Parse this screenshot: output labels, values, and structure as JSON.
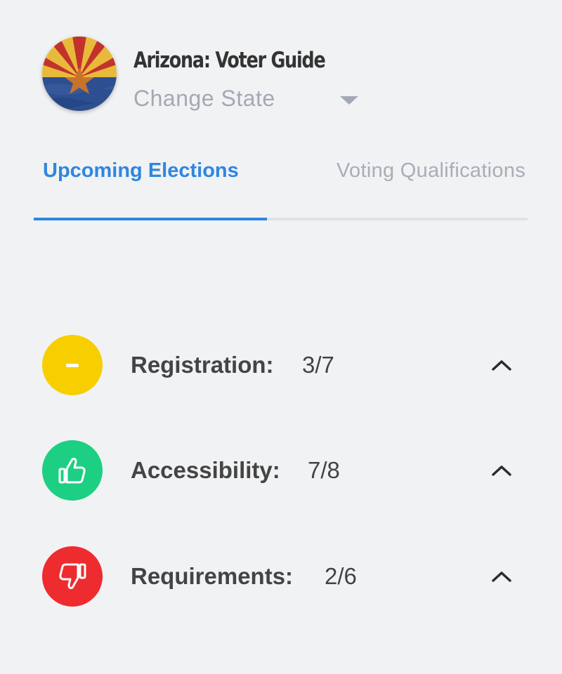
{
  "header": {
    "title": "Arizona: Voter Guide",
    "change_state_label": "Change State",
    "flag_icon": "arizona-flag-icon",
    "dropdown_icon": "caret-down-icon"
  },
  "tabs": [
    {
      "label": "Upcoming Elections",
      "active": true
    },
    {
      "label": "Voting Qualifications",
      "active": false
    }
  ],
  "colors": {
    "accent": "#2f86e0",
    "neutral": "#f7cf00",
    "positive": "#1ccf83",
    "negative": "#ee2b2f"
  },
  "categories": [
    {
      "label": "Registration:",
      "score": "3/7",
      "status": "neutral",
      "icon": "minus-icon"
    },
    {
      "label": "Accessibility:",
      "score": "7/8",
      "status": "positive",
      "icon": "thumbs-up-icon"
    },
    {
      "label": "Requirements:",
      "score": "2/6",
      "status": "negative",
      "icon": "thumbs-down-icon"
    }
  ]
}
